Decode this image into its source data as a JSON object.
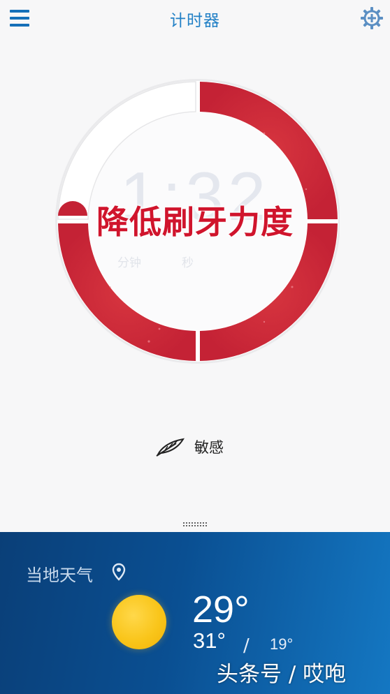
{
  "header": {
    "title": "计时器",
    "menu_icon": "hamburger-menu-icon",
    "settings_icon": "gear-plus-icon"
  },
  "timer": {
    "time": "1:32",
    "minutes_label": "分钟",
    "seconds_label": "秒",
    "progress_quadrants_filled": 3,
    "progress_total_quadrants": 4,
    "ring_color": "#cf2a3c",
    "ring_empty_color": "#ffffff"
  },
  "overlay": {
    "text": "降低刷牙力度"
  },
  "mode": {
    "icon": "feather-icon",
    "label": "敏感"
  },
  "weather": {
    "label": "当地天气",
    "location_icon": "location-pin-icon",
    "condition_icon": "sun-icon",
    "current_temp": "29°",
    "high_temp": "31°",
    "separator": "/",
    "low_temp": "19°",
    "background": "#0a4f92"
  },
  "watermark": "头条号 / 哎咆"
}
